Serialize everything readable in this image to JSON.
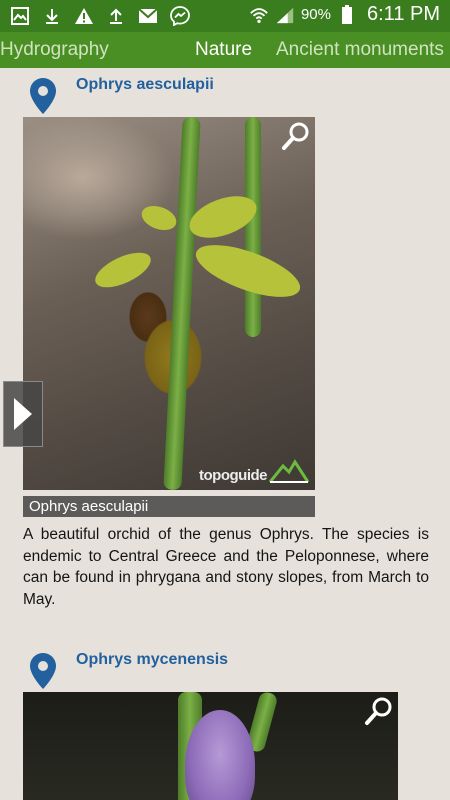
{
  "status_bar": {
    "battery": "90%",
    "time": "6:11 PM",
    "left_icons": [
      "image-icon",
      "download-icon",
      "warning-icon",
      "upload-icon",
      "mail-icon",
      "messenger-icon"
    ],
    "right_icons": [
      "wifi-icon",
      "signal-icon",
      "battery-icon"
    ]
  },
  "tabs": [
    {
      "label": "Hydrography",
      "active": false
    },
    {
      "label": "Nature",
      "active": true
    },
    {
      "label": "Ancient monuments",
      "active": false
    }
  ],
  "items": [
    {
      "title": "Ophrys aesculapii",
      "caption": "Ophrys aesculapii",
      "description": "A beautiful orchid of the genus Ophrys. The species is endemic to Central Greece and the Peloponnese, where can be found in phrygana and stony slopes, from March to May.",
      "watermark": "topoguide"
    },
    {
      "title": "Ophrys mycenensis"
    }
  ],
  "colors": {
    "status_bar": "#3a7d1f",
    "tab_bar": "#4a8f23",
    "title": "#22609e",
    "pin": "#22609e",
    "background": "#e6e2db"
  }
}
